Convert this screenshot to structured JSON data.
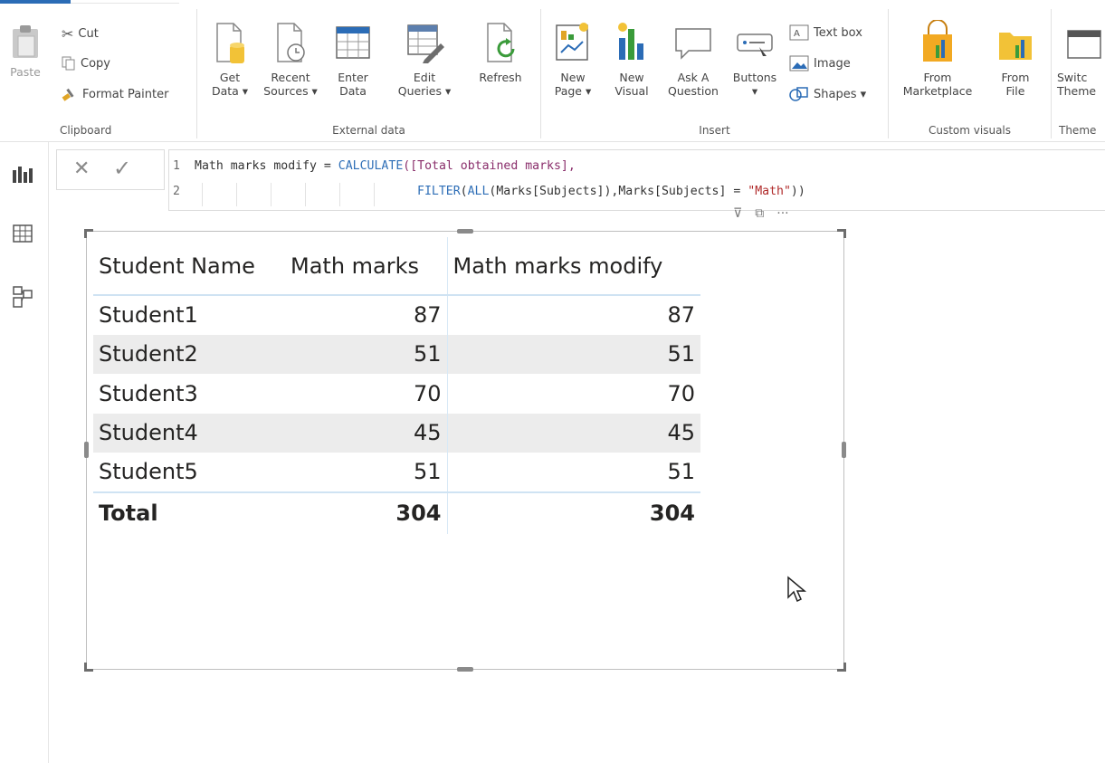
{
  "ribbon": {
    "clipboard": {
      "paste": "Paste",
      "cut": "Cut",
      "copy": "Copy",
      "format_painter": "Format Painter",
      "label": "Clipboard"
    },
    "external_data": {
      "get_data": [
        "Get",
        "Data ▾"
      ],
      "recent_sources": [
        "Recent",
        "Sources ▾"
      ],
      "enter_data": [
        "Enter",
        "Data"
      ],
      "edit_queries": [
        "Edit",
        "Queries ▾"
      ],
      "refresh": "Refresh",
      "label": "External data"
    },
    "insert": {
      "new_page": [
        "New",
        "Page ▾"
      ],
      "new_visual": [
        "New",
        "Visual"
      ],
      "ask_question": [
        "Ask A",
        "Question"
      ],
      "buttons": [
        "Buttons",
        "▾"
      ],
      "text_box": "Text box",
      "image": "Image",
      "shapes": "Shapes ▾",
      "label": "Insert"
    },
    "custom_visuals": {
      "from_marketplace": [
        "From",
        "Marketplace"
      ],
      "from_file": [
        "From",
        "File"
      ],
      "label": "Custom visuals"
    },
    "themes": {
      "switch_theme": [
        "Switc",
        "Theme"
      ],
      "label": "Theme"
    }
  },
  "formula_bar": {
    "line1_num": "1",
    "line1_a": "Math marks modify = ",
    "line1_fn": "CALCULATE",
    "line1_b": "([Total obtained marks],",
    "line2_num": "2",
    "line2_fn1": "FILTER",
    "line2_p1": "(",
    "line2_fn2": "ALL",
    "line2_p2": "(Marks[Subjects]),Marks[Subjects] = ",
    "line2_str": "\"Math\"",
    "line2_end": "))"
  },
  "table": {
    "headers": [
      "Student Name",
      "Math marks",
      "Math marks modify"
    ],
    "rows": [
      [
        "Student1",
        "87",
        "87"
      ],
      [
        "Student2",
        "51",
        "51"
      ],
      [
        "Student3",
        "70",
        "70"
      ],
      [
        "Student4",
        "45",
        "45"
      ],
      [
        "Student5",
        "51",
        "51"
      ]
    ],
    "total": [
      "Total",
      "304",
      "304"
    ]
  },
  "colors": {
    "accent": "#2b6cb6",
    "dax_function": "#2f6fb7",
    "dax_string": "#b02a2a",
    "row_alt": "#ececec"
  }
}
